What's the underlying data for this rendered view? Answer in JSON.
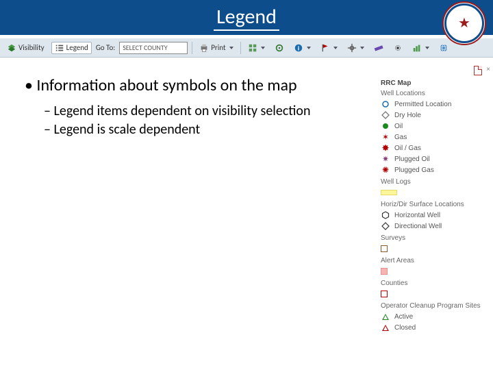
{
  "header": {
    "title": "Legend"
  },
  "toolbar": {
    "visibility_label": "Visibility",
    "legend_label": "Legend",
    "goto_label": "Go To:",
    "county_select_text": "SELECT COUNTY",
    "print_label": "Print"
  },
  "content": {
    "main_bullet": "Information about symbols on the map",
    "sub1": "Legend items dependent on visibility selection",
    "sub2": "Legend is scale dependent"
  },
  "legend": {
    "title": "RRC Map",
    "well_locations_header": "Well Locations",
    "well_items": [
      {
        "label": "Permitted Location",
        "color": "#1b6db0",
        "kind": "circle-outline"
      },
      {
        "label": "Dry Hole",
        "color": "#777777",
        "kind": "diamond-outline"
      },
      {
        "label": "Oil",
        "color": "#1a8a1a",
        "kind": "circle-solid"
      },
      {
        "label": "Gas",
        "color": "#b00000",
        "kind": "starburst"
      },
      {
        "label": "Oil / Gas",
        "color": "#b00000",
        "kind": "starburst-bold"
      },
      {
        "label": "Plugged Oil",
        "color": "#8a3a7a",
        "kind": "starburst-outline"
      },
      {
        "label": "Plugged Gas",
        "color": "#b00000",
        "kind": "starburst-dashed"
      }
    ],
    "well_logs_header": "Well Logs",
    "horiz_header": "Horiz/Dir Surface Locations",
    "horiz_items": [
      {
        "label": "Horizontal Well",
        "color": "#333333",
        "kind": "hexagon-outline"
      },
      {
        "label": "Directional Well",
        "color": "#333333",
        "kind": "diamond-outline"
      }
    ],
    "surveys_header": "Surveys",
    "alert_header": "Alert Areas",
    "counties_header": "Counties",
    "ocp_header": "Operator Cleanup Program Sites",
    "ocp_items": [
      {
        "label": "Active",
        "kind": "tri-green"
      },
      {
        "label": "Closed",
        "kind": "tri-red"
      }
    ]
  }
}
